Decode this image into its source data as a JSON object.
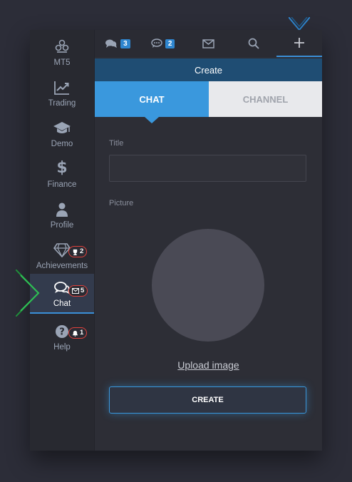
{
  "sidebar": {
    "items": [
      {
        "label": "MT5",
        "icon": "mt5-icon"
      },
      {
        "label": "Trading",
        "icon": "chart-up-icon"
      },
      {
        "label": "Demo",
        "icon": "graduation-cap-icon"
      },
      {
        "label": "Finance",
        "icon": "dollar-icon"
      },
      {
        "label": "Profile",
        "icon": "user-icon"
      },
      {
        "label": "Achievements",
        "icon": "diamond-icon",
        "badge": "2"
      },
      {
        "label": "Chat",
        "icon": "chat-bubbles-icon",
        "badge": "5",
        "active": true
      },
      {
        "label": "Help",
        "icon": "question-icon",
        "badge": "1"
      }
    ]
  },
  "topbar": {
    "chats_count": "3",
    "messages_count": "2"
  },
  "panel": {
    "header": "Create",
    "tabs": {
      "chat": "CHAT",
      "channel": "CHANNEL"
    },
    "title_label": "Title",
    "title_value": "",
    "picture_label": "Picture",
    "upload_label": "Upload image",
    "create_button": "CREATE"
  },
  "colors": {
    "accent": "#3a98dd",
    "badge_red": "#e0413c",
    "header_bg": "#1f4d73"
  }
}
